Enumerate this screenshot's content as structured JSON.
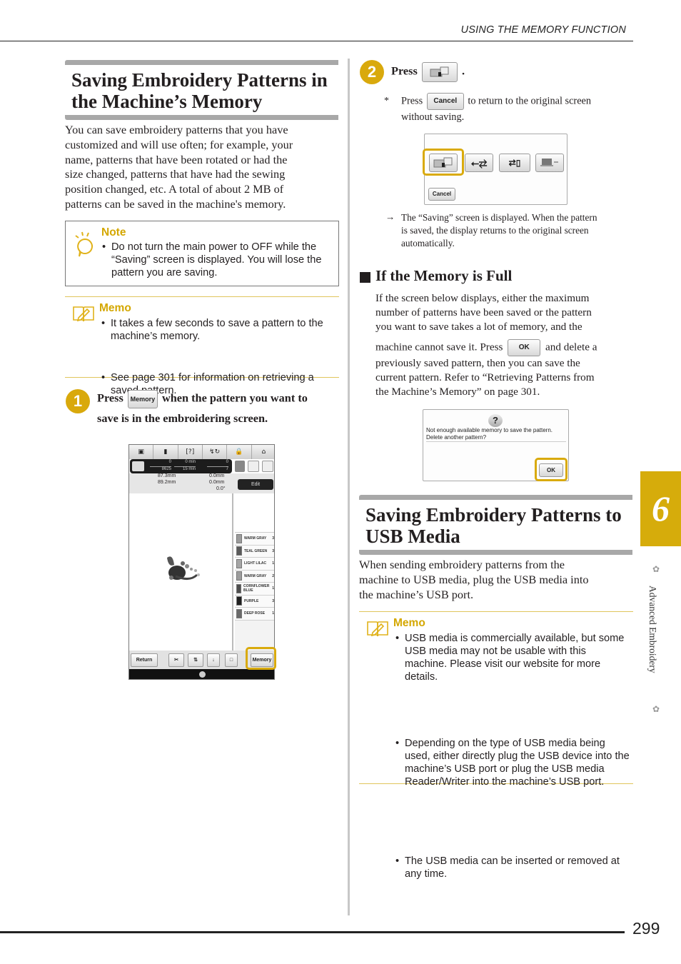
{
  "running_head": "USING THE MEMORY FUNCTION",
  "page_number": "299",
  "chapter": {
    "number": "6",
    "title": "Advanced Embroidery"
  },
  "left": {
    "section_title_line1": "Saving Embroidery Patterns in",
    "section_title_line2": "the Machine’s Memory",
    "intro": [
      "You can save embroidery patterns that you have",
      "customized and will use often; for example, your",
      "name, patterns that have been rotated or had the",
      "size changed, patterns that have had the sewing",
      "position changed, etc. A total of about 2 MB of",
      "patterns can be saved in the machine's memory."
    ],
    "note": {
      "title": "Note",
      "items": [
        "Do not turn the main power to OFF while the “Saving” screen is displayed. You will lose the pattern you are saving."
      ]
    },
    "memo": {
      "title": "Memo",
      "items": [
        "It takes a few seconds to save a pattern to the machine’s memory.",
        "See page 301 for information on retrieving a saved pattern."
      ]
    },
    "step1": {
      "number": "1",
      "press": "Press",
      "button": "Memory",
      "rest_line1": "when the pattern you want to",
      "line2": "save is in the embroidering screen."
    },
    "screen": {
      "stitch_count_top": "0",
      "stitch_count_total": "8625",
      "time_top": "0 min",
      "time_total": "15 min",
      "color_top": "0",
      "color_total": "7",
      "width": "87.3mm",
      "height": "89.2mm",
      "offset_v": "0.0mm",
      "offset_h": "0.0mm",
      "angle": "0.0°",
      "edit_button": "Edit",
      "threads": [
        {
          "name": "WARM GRAY",
          "count": "3",
          "color": "#9c9c9c"
        },
        {
          "name": "TEAL GREEN",
          "count": "3",
          "color": "#5a5a5a"
        },
        {
          "name": "LIGHT LILAC",
          "count": "1",
          "color": "#a5a5a5"
        },
        {
          "name": "WARM GRAY",
          "count": "2",
          "color": "#9c9c9c"
        },
        {
          "name": "CORNFLOWER BLUE",
          "count": "1",
          "color": "#4d4d4d"
        },
        {
          "name": "PURPLE",
          "count": "3",
          "color": "#1f1f1f"
        },
        {
          "name": "DEEP ROSE",
          "count": "1",
          "color": "#6a6a6a"
        }
      ],
      "time_unit": "min",
      "return_button": "Return",
      "memory_button": "Memory"
    }
  },
  "right": {
    "step2": {
      "number": "2",
      "press": "Press",
      "period": ".",
      "asterisk_note_pre": "Press",
      "cancel_button": "Cancel",
      "asterisk_note_post": "to return to the original screen",
      "asterisk_note_line2": "without saving."
    },
    "save_dialog": {
      "cancel_button": "Cancel"
    },
    "result": [
      "The “Saving” screen is displayed. When the pattern",
      "is saved, the display returns to the original screen",
      "automatically."
    ],
    "memory_full": {
      "heading": "If the Memory is Full",
      "lines": [
        "If the screen below displays, either the maximum",
        "number of patterns have been saved or the pattern",
        "you want to save takes a lot of memory, and the"
      ],
      "ok_pre": "machine cannot save it. Press",
      "ok_button": "OK",
      "ok_post": "and delete a",
      "lines2": [
        "previously saved pattern, then you can save the",
        "current pattern. Refer to “Retrieving Patterns from",
        "the Machine’s Memory” on page 301."
      ]
    },
    "full_dialog": {
      "message_line1": "Not enough available memory to save the pattern.",
      "message_line2": "Delete another pattern?",
      "ok_button": "OK"
    },
    "usb_section": {
      "title_line1": "Saving Embroidery Patterns to",
      "title_line2": "USB Media",
      "intro": [
        "When sending embroidery patterns from the",
        "machine to USB media, plug the USB media into",
        "the machine’s USB port."
      ],
      "memo": {
        "title": "Memo",
        "items": [
          "USB media is commercially available, but some USB media may not be usable with this machine. Please visit our website for more details.",
          "Depending on the type of USB media being used, either directly plug the USB device into the machine’s USB port or plug the USB media Reader/Writer into the machine’s USB port.",
          "The USB media can be inserted or removed at any time."
        ]
      }
    }
  }
}
